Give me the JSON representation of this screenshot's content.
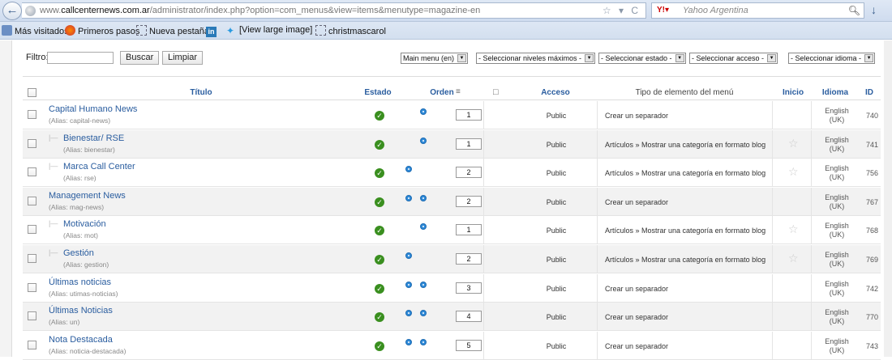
{
  "browser": {
    "url_prefix": "www.",
    "url_domain": "callcenternews.com.ar",
    "url_path": "/administrator/index.php?option=com_menus&view=items&menutype=magazine-en",
    "search_engine": "Yahoo Argentina",
    "bookmarks": [
      "Más visitados",
      "Primeros pasos",
      "Nueva pestaña",
      "[View large image]",
      "christmascarol"
    ]
  },
  "filters": {
    "label": "Filtro:",
    "search_value": "",
    "buscar_label": "Buscar",
    "limpiar_label": "Limpiar",
    "menu_select": "Main menu (en)",
    "niveles_select": "- Seleccionar niveles máximos -",
    "estado_select": "- Seleccionar estado -",
    "acceso_select": "- Seleccionar acceso -",
    "idioma_select": "- Seleccionar idioma -"
  },
  "columns": {
    "titulo": "Título",
    "estado": "Estado",
    "orden": "Orden",
    "acceso": "Acceso",
    "tipo": "Tipo de elemento del menú",
    "inicio": "Inicio",
    "idioma": "Idioma",
    "id": "ID"
  },
  "rows": [
    {
      "title": "Capital Humano News",
      "alias": "capital-news",
      "level": 1,
      "order": "1",
      "arrows": "down",
      "access": "Public",
      "type": "Crear un separador",
      "home": false,
      "lang1": "English",
      "lang2": "(UK)",
      "id": "740"
    },
    {
      "title": "Bienestar/ RSE",
      "alias": "bienestar",
      "level": 2,
      "order": "1",
      "arrows": "down",
      "access": "Public",
      "type": "Artículos » Mostrar una categoría en formato blog",
      "home": true,
      "lang1": "English",
      "lang2": "(UK)",
      "id": "741"
    },
    {
      "title": "Marca Call Center",
      "alias": "rse",
      "level": 2,
      "order": "2",
      "arrows": "up",
      "access": "Public",
      "type": "Artículos » Mostrar una categoría en formato blog",
      "home": true,
      "lang1": "English",
      "lang2": "(UK)",
      "id": "756"
    },
    {
      "title": "Management News",
      "alias": "mag-news",
      "level": 1,
      "order": "2",
      "arrows": "both",
      "access": "Public",
      "type": "Crear un separador",
      "home": false,
      "lang1": "English",
      "lang2": "(UK)",
      "id": "767"
    },
    {
      "title": "Motivación",
      "alias": "mot",
      "level": 2,
      "order": "1",
      "arrows": "down",
      "access": "Public",
      "type": "Artículos » Mostrar una categoría en formato blog",
      "home": true,
      "lang1": "English",
      "lang2": "(UK)",
      "id": "768"
    },
    {
      "title": "Gestión",
      "alias": "gestion",
      "level": 2,
      "order": "2",
      "arrows": "up",
      "access": "Public",
      "type": "Artículos » Mostrar una categoría en formato blog",
      "home": true,
      "lang1": "English",
      "lang2": "(UK)",
      "id": "769"
    },
    {
      "title": "Últimas noticias",
      "alias": "utimas-noticias",
      "level": 1,
      "order": "3",
      "arrows": "both",
      "access": "Public",
      "type": "Crear un separador",
      "home": false,
      "lang1": "English",
      "lang2": "(UK)",
      "id": "742"
    },
    {
      "title": "Últimas Noticias",
      "alias": "un",
      "level": 1,
      "order": "4",
      "arrows": "both",
      "access": "Public",
      "type": "Crear un separador",
      "home": false,
      "lang1": "English",
      "lang2": "(UK)",
      "id": "770"
    },
    {
      "title": "Nota Destacada",
      "alias": "noticia-destacada",
      "level": 1,
      "order": "5",
      "arrows": "both",
      "access": "Public",
      "type": "Crear un separador",
      "home": false,
      "lang1": "English",
      "lang2": "(UK)",
      "id": "743"
    }
  ]
}
